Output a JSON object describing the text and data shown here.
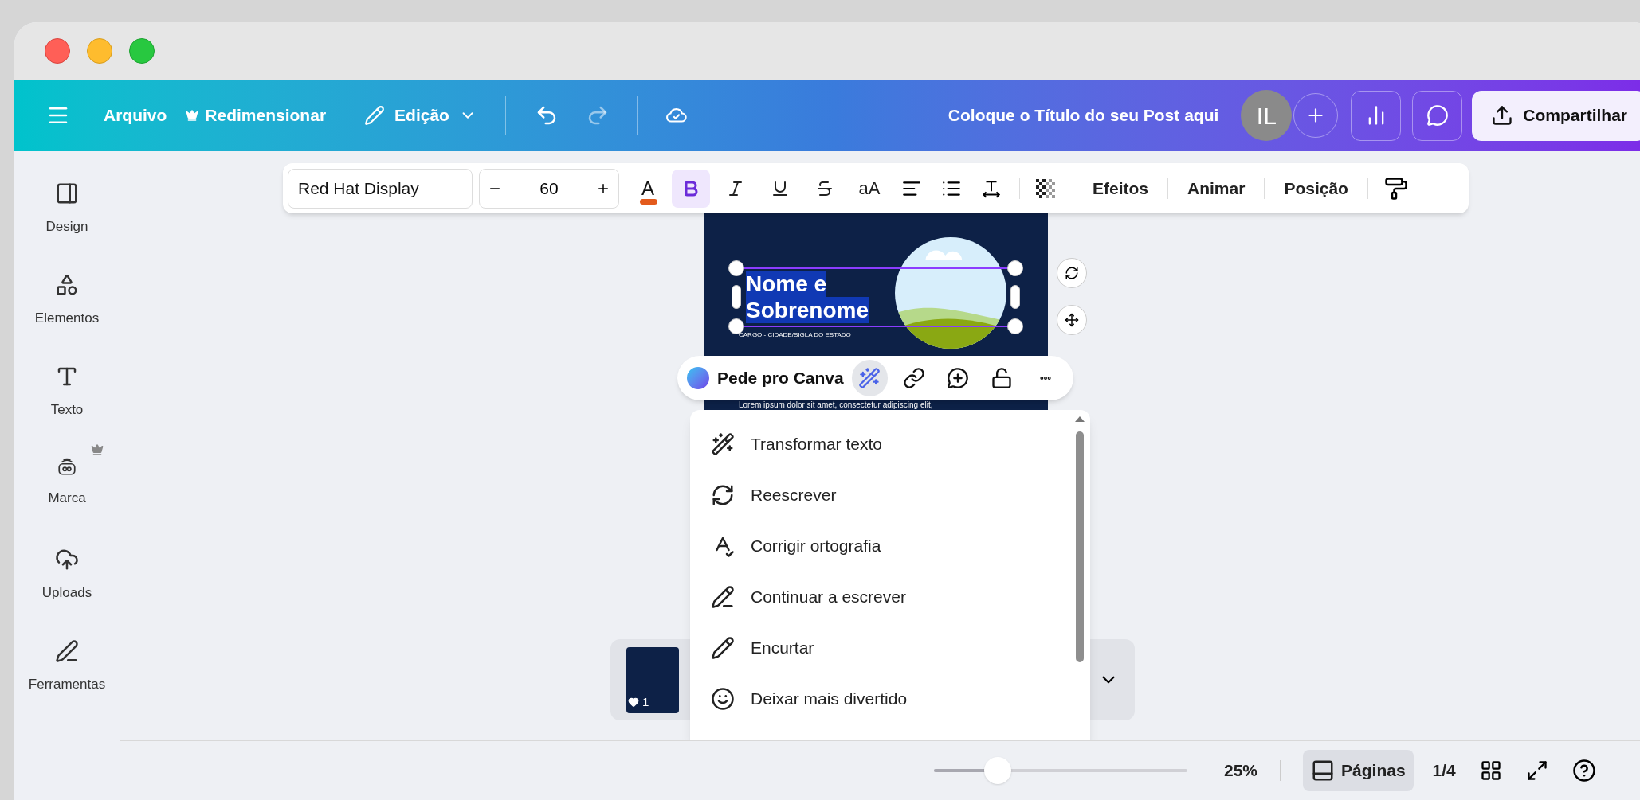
{
  "topbar": {
    "menu": [
      {
        "kind": "file",
        "label": "Arquivo"
      },
      {
        "kind": "resize",
        "label": "Redimensionar"
      },
      {
        "kind": "edit",
        "label": "Edição"
      }
    ],
    "title": "Coloque o Título do seu Post aqui",
    "avatar": "IL",
    "share": "Compartilhar"
  },
  "sidebar": [
    {
      "kind": "design",
      "label": "Design",
      "premium": false
    },
    {
      "kind": "elements",
      "label": "Elementos",
      "premium": false
    },
    {
      "kind": "text",
      "label": "Texto",
      "premium": false
    },
    {
      "kind": "brand",
      "label": "Marca",
      "premium": true
    },
    {
      "kind": "uploads",
      "label": "Uploads",
      "premium": false
    },
    {
      "kind": "tools",
      "label": "Ferramentas",
      "premium": false
    }
  ],
  "text_toolbar": {
    "font": "Red Hat Display",
    "size": "60",
    "color_letter": "A",
    "formats": [
      {
        "kind": "bold",
        "selected": true
      },
      {
        "kind": "italic",
        "selected": false
      },
      {
        "kind": "underline",
        "selected": false
      },
      {
        "kind": "strike",
        "selected": false
      }
    ],
    "case": "aA",
    "actions": [
      "Efeitos",
      "Animar",
      "Posição"
    ]
  },
  "design": {
    "name_lines": [
      "Nome e",
      "Sobrenome"
    ],
    "subtitle": "CARGO - CIDADE/SIGLA DO ESTADO",
    "body": "Lorem ipsum dolor sit amet, consectetur adipiscing elit,"
  },
  "element_toolbar": {
    "ask": "Pede pro Canva",
    "tools": [
      {
        "kind": "magic",
        "selected": true
      },
      {
        "kind": "link",
        "selected": false
      },
      {
        "kind": "comment",
        "selected": false
      },
      {
        "kind": "lock",
        "selected": false
      },
      {
        "kind": "more",
        "selected": false
      }
    ]
  },
  "ai_menu": [
    {
      "kind": "transform",
      "label": "Transformar texto"
    },
    {
      "kind": "rewrite",
      "label": "Reescrever"
    },
    {
      "kind": "spelling",
      "label": "Corrigir ortografia"
    },
    {
      "kind": "continue",
      "label": "Continuar a escrever"
    },
    {
      "kind": "shorten",
      "label": "Encurtar"
    },
    {
      "kind": "fun",
      "label": "Deixar mais divertido"
    }
  ],
  "pages": {
    "count": "1"
  },
  "footer": {
    "zoom": {
      "level": 0.25,
      "reading": "25%"
    },
    "pages_button": {
      "label": "Páginas",
      "selected": true
    },
    "page_indicator": "1/4"
  }
}
